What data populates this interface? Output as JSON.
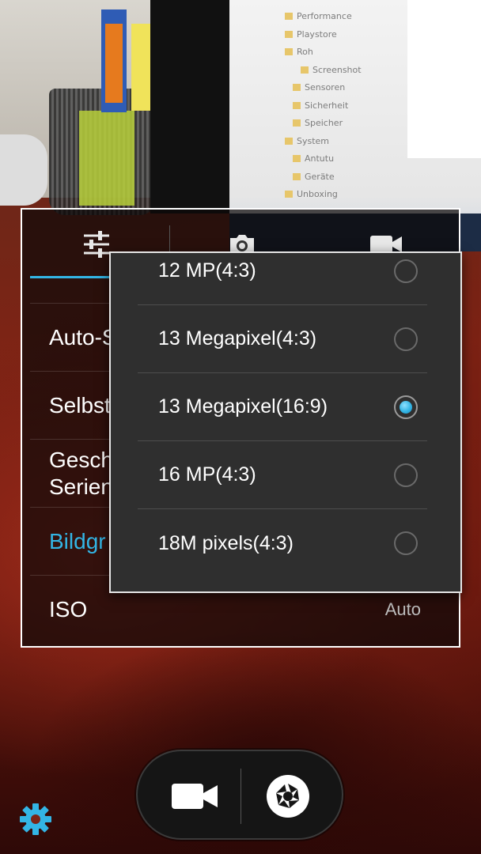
{
  "viewfinder": {
    "screen_tree": [
      "Performance",
      "Playstore",
      "Roh",
      "Screenshot",
      "Sensoren",
      "Sicherheit",
      "Speicher",
      "System",
      "Antutu",
      "Geräte",
      "Unboxing"
    ]
  },
  "settings_panel": {
    "tabs": [
      {
        "icon": "sliders-icon",
        "selected": true
      },
      {
        "icon": "camera-icon",
        "selected": false
      },
      {
        "icon": "video-camera-icon",
        "selected": false
      }
    ],
    "rows": [
      {
        "label": "Auto-S",
        "value": ""
      },
      {
        "label": "Selbst",
        "value": ""
      },
      {
        "label": "Gesch\nSerien",
        "value": ""
      },
      {
        "label": "Bildgr",
        "value": "",
        "active": true
      },
      {
        "label": "ISO",
        "value": "Auto"
      }
    ]
  },
  "picture_size_dialog": {
    "options": [
      {
        "label": "12 MP(4:3)",
        "selected": false
      },
      {
        "label": "13 Megapixel(4:3)",
        "selected": false
      },
      {
        "label": "13 Megapixel(16:9)",
        "selected": true
      },
      {
        "label": "16 MP(4:3)",
        "selected": false
      },
      {
        "label": "18M pixels(4:3)",
        "selected": false
      }
    ]
  },
  "controls": {
    "video_icon": "video-camera-icon",
    "shutter_icon": "aperture-shutter-icon",
    "settings_icon": "gear-icon"
  },
  "colors": {
    "accent": "#33b5e5",
    "panel_border": "#ffffff",
    "dialog_bg": "#2f2f2f"
  }
}
